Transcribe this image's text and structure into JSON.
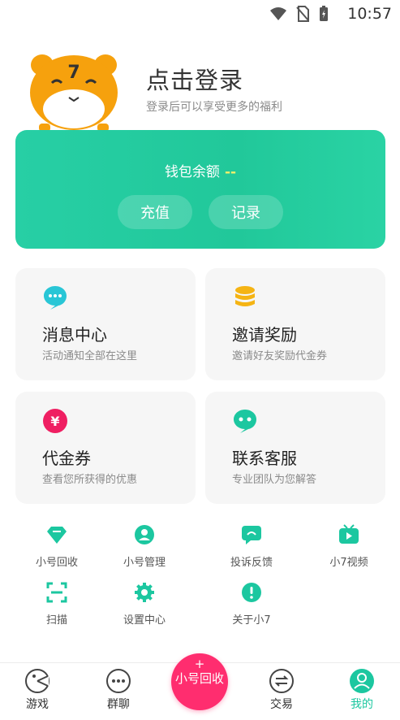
{
  "status_bar": {
    "time": "10:57"
  },
  "login": {
    "title": "点击登录",
    "subtitle": "登录后可以享受更多的福利",
    "mascot_text": "7"
  },
  "wallet": {
    "label": "钱包余额",
    "amount": "--",
    "recharge": "充值",
    "record": "记录"
  },
  "cards": [
    {
      "title": "消息中心",
      "subtitle": "活动通知全部在这里",
      "icon": "chat-bubble-icon",
      "color": "#29c6d6"
    },
    {
      "title": "邀请奖励",
      "subtitle": "邀请好友奖励代金券",
      "icon": "coin-stack-icon",
      "color": "#f5b414"
    },
    {
      "title": "代金券",
      "subtitle": "查看您所获得的优惠",
      "icon": "yen-coupon-icon",
      "color": "#ef1f62"
    },
    {
      "title": "联系客服",
      "subtitle": "专业团队为您解答",
      "icon": "service-chat-icon",
      "color": "#1cc7a0"
    }
  ],
  "grid": [
    {
      "label": "小号回收",
      "icon": "diamond-icon"
    },
    {
      "label": "小号管理",
      "icon": "account-manage-icon"
    },
    {
      "label": "投诉反馈",
      "icon": "feedback-icon"
    },
    {
      "label": "小7视频",
      "icon": "tv-play-icon"
    },
    {
      "label": "扫描",
      "icon": "scan-icon"
    },
    {
      "label": "设置中心",
      "icon": "gear-icon"
    },
    {
      "label": "关于小7",
      "icon": "info-icon"
    }
  ],
  "tabbar": {
    "games": "游戏",
    "group_chat": "群聊",
    "center_plus": "+",
    "center_label": "小号回收",
    "trade": "交易",
    "mine": "我的"
  },
  "colors": {
    "accent": "#1cc7a0",
    "center_button": "#ff2d6f",
    "wallet_amount": "#f2f06a"
  }
}
